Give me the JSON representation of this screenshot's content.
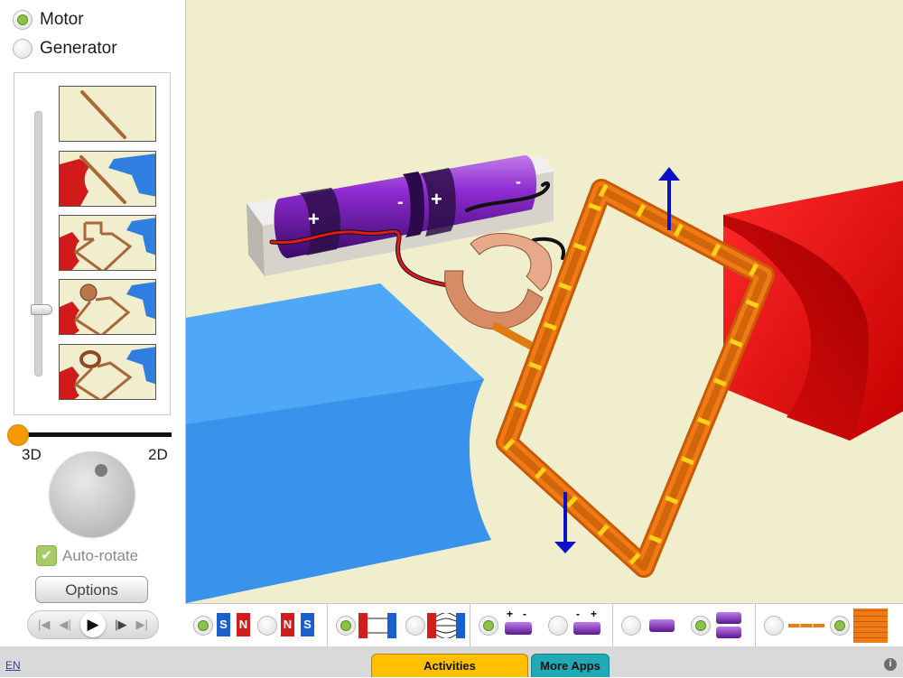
{
  "mode": {
    "options": [
      {
        "label": "Motor",
        "selected": true
      },
      {
        "label": "Generator",
        "selected": false
      }
    ]
  },
  "steps_panel": {
    "thumbnails": [
      "straight-wire",
      "wire-between-magnets",
      "square-loop",
      "loop-with-commutator",
      "loop-with-split-ring"
    ],
    "selected_step": 4
  },
  "view_slider": {
    "left_label": "3D",
    "right_label": "2D",
    "value": 0
  },
  "auto_rotate": {
    "label": "Auto-rotate",
    "checked": true
  },
  "options_button": {
    "label": "Options"
  },
  "battery": {
    "plus": "+",
    "minus": "-"
  },
  "toolbar": {
    "magnet_poles": {
      "s": "S",
      "n": "N"
    },
    "battery_signs": {
      "plus": "+",
      "minus": "-"
    }
  },
  "footer": {
    "lang": "EN",
    "activities_label": "Activities",
    "more_apps_label": "More Apps",
    "info": "i"
  },
  "colors": {
    "accent_green": "#8bc34a",
    "activities_tab": "#ffc000",
    "more_apps_tab": "#21a9b5",
    "slider_knob": "#f39a00",
    "scene_bg": "#f1eecd"
  }
}
